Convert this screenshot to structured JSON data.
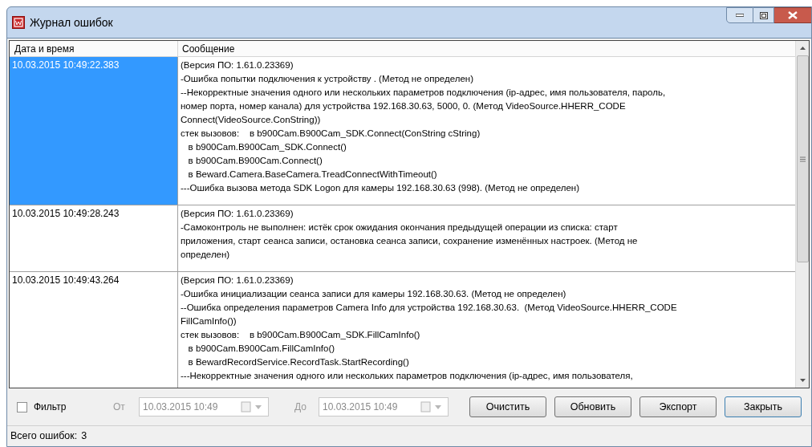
{
  "window": {
    "title": "Журнал ошибок"
  },
  "table": {
    "columns": [
      "Дата и время",
      "Сообщение"
    ],
    "rows": [
      {
        "selected": true,
        "date": "10.03.2015 10:49:22.383",
        "message": [
          "(Версия ПО: 1.61.0.23369)",
          "-Ошибка попытки подключения к устройству . (Метод не определен)",
          "--Некорректные значения одного или нескольких параметров подключения (ip-адрес, имя пользователя, пароль,",
          "номер порта, номер канала) для устройства 192.168.30.63, 5000, 0. (Метод VideoSource.HHERR_CODE",
          "Connect(VideoSource.ConString))",
          "стек вызовов:    в b900Cam.B900Cam_SDK.Connect(ConString cString)",
          "   в b900Cam.B900Cam_SDK.Connect()",
          "   в b900Cam.B900Cam.Connect()",
          "   в Beward.Camera.BaseCamera.TreadConnectWithTimeout()",
          "---Ошибка вызова метода SDK Logon для камеры 192.168.30.63 (998). (Метод не определен)"
        ]
      },
      {
        "selected": false,
        "date": "10.03.2015 10:49:28.243",
        "message": [
          "(Версия ПО: 1.61.0.23369)",
          "-Самоконтроль не выполнен: истёк срок ожидания окончания предыдущей операции из списка: старт",
          "приложения, старт сеанса записи, остановка сеанса записи, сохранение изменённых настроек. (Метод не",
          "определен)"
        ]
      },
      {
        "selected": false,
        "date": "10.03.2015 10:49:43.264",
        "message": [
          "(Версия ПО: 1.61.0.23369)",
          "-Ошибка инициализации сеанса записи для камеры 192.168.30.63. (Метод не определен)",
          "--Ошибка определения параметров Camera Info для устройства 192.168.30.63.  (Метод VideoSource.HHERR_CODE",
          "FillCamInfo())",
          "стек вызовов:    в b900Cam.B900Cam_SDK.FillCamInfo()",
          "   в b900Cam.B900Cam.FillCamInfo()",
          "   в BewardRecordService.RecordTask.StartRecording()",
          "---Некорректные значения одного или нескольких параметров подключения (ip-адрес, имя пользователя,"
        ]
      }
    ]
  },
  "filter": {
    "label": "Фильтр",
    "checked": false,
    "from_label": "От",
    "from_value": "10.03.2015 10:49",
    "to_label": "До",
    "to_value": "10.03.2015 10:49",
    "disabled": true
  },
  "buttons": [
    "Очистить",
    "Обновить",
    "Экспорт",
    "Закрыть"
  ],
  "status_bar": {
    "label": "Всего ошибок:",
    "count": "3"
  }
}
